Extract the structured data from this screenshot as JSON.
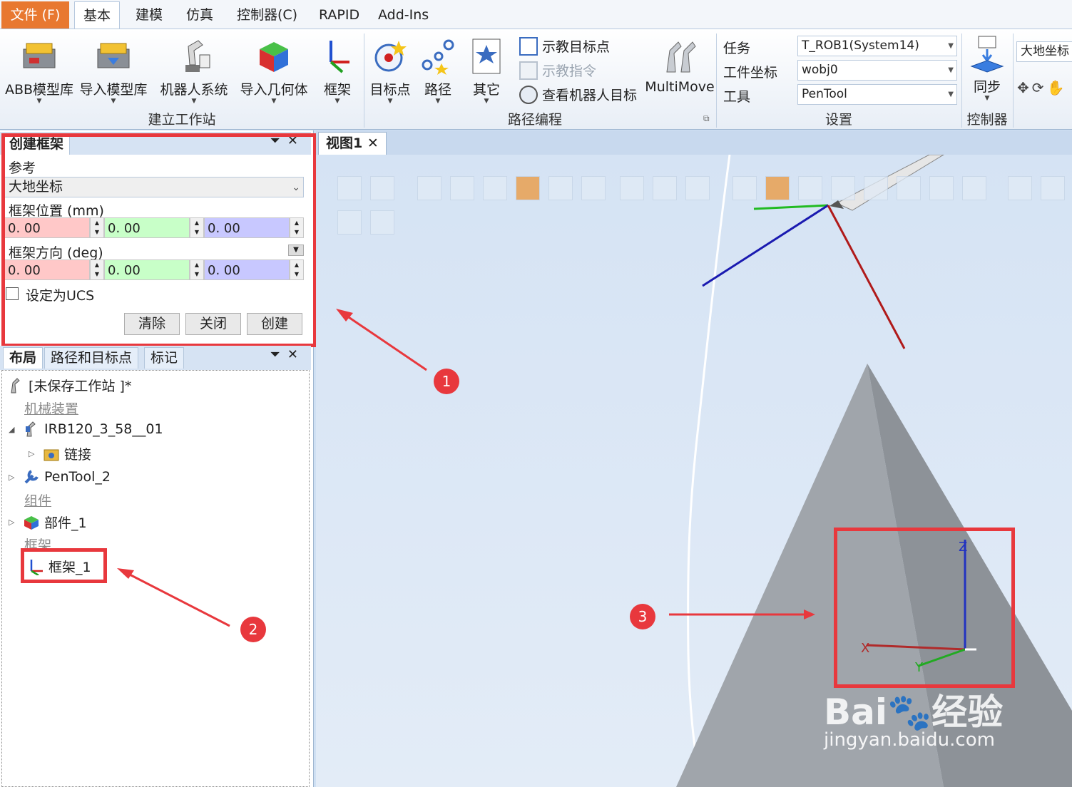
{
  "menu": {
    "file": "文件 (F)",
    "tabs": [
      "基本",
      "建模",
      "仿真",
      "控制器(C)",
      "RAPID",
      "Add-Ins"
    ]
  },
  "ribbon": {
    "build_station": {
      "abb_library": "ABB模型库",
      "import_library": "导入模型库",
      "robot_system": "机器人系统",
      "import_geometry": "导入几何体",
      "frame": "框架",
      "group_label": "建立工作站"
    },
    "path_programming": {
      "target": "目标点",
      "path": "路径",
      "other": "其它",
      "teach_target": "示教目标点",
      "teach_instruction": "示教指令",
      "view_robot_target": "查看机器人目标",
      "multimove": "MultiMove",
      "group_label": "路径编程"
    },
    "settings": {
      "task_label": "任务",
      "task_value": "T_ROB1(System14)",
      "workobj_label": "工件坐标",
      "workobj_value": "wobj0",
      "tool_label": "工具",
      "tool_value": "PenTool",
      "group_label": "设置"
    },
    "controller": {
      "sync": "同步",
      "group_label": "控制器"
    },
    "world_frame_combo": "大地坐标"
  },
  "create_frame_panel": {
    "title": "创建框架",
    "reference_label": "参考",
    "reference_value": "大地坐标",
    "position_label": "框架位置 (mm)",
    "position": [
      "0. 00",
      "0. 00",
      "0. 00"
    ],
    "orientation_label": "框架方向 (deg)",
    "orientation": [
      "0. 00",
      "0. 00",
      "0. 00"
    ],
    "set_ucs_label": "设定为UCS",
    "clear_button": "清除",
    "close_button": "关闭",
    "create_button": "创建"
  },
  "layout_panel": {
    "tabs": [
      "布局",
      "路径和目标点",
      "标记"
    ],
    "station": "[未保存工作站 ]*",
    "mechanisms_header": "机械装置",
    "robot": "IRB120_3_58__01",
    "links": "链接",
    "tool": "PenTool_2",
    "components_header": "组件",
    "part": "部件_1",
    "frames_header": "框架",
    "frame_item": "框架_1"
  },
  "viewport": {
    "tab": "视图1",
    "axis_z": "Z",
    "axis_x": "X",
    "axis_y": "Y"
  },
  "annotations": [
    "1",
    "2",
    "3"
  ],
  "watermark": {
    "brand": "Bai",
    "brand2": "经验",
    "url": "jingyan.baidu.com"
  },
  "colors": {
    "annotation_red": "#e8383d",
    "file_tab_orange": "#e87830",
    "x_field": "#ffc8c8",
    "y_field": "#c8ffc8",
    "z_field": "#c8c8ff"
  }
}
